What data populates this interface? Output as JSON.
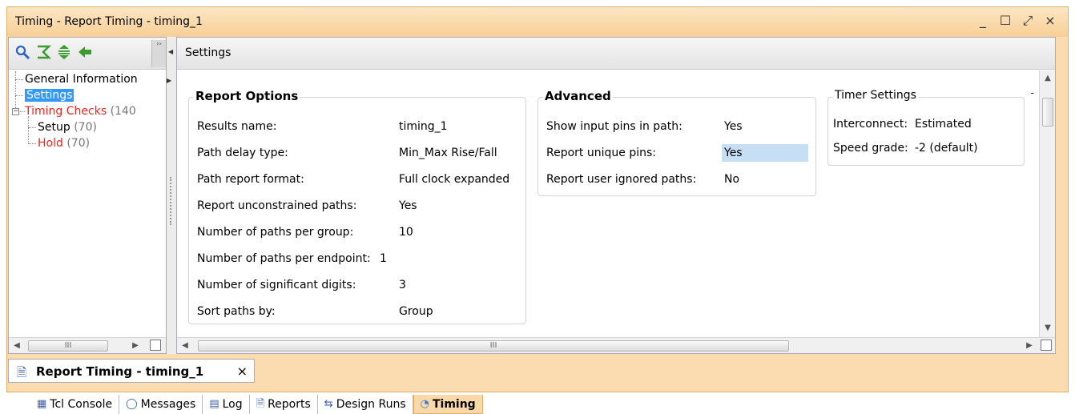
{
  "window": {
    "title": "Timing - Report Timing - timing_1",
    "controls": {
      "minimize": "_",
      "maximize": "☐",
      "restore": "⤢",
      "close": "×"
    }
  },
  "left_panel": {
    "toolbar_icons": [
      "search-icon",
      "sum-icon",
      "expand-icon",
      "back-icon"
    ],
    "tree": {
      "general": "General Information",
      "settings": "Settings",
      "timing_checks": "Timing Checks",
      "timing_checks_count": "(140",
      "setup": "Setup",
      "setup_count": "(70)",
      "hold": "Hold",
      "hold_count": "(70)"
    },
    "scroll_thumb": "III"
  },
  "right_panel": {
    "header": "Settings",
    "scroll_thumb": "III",
    "report_options": {
      "title": "Report Options",
      "rows": [
        {
          "label": "Results name:",
          "value": "timing_1"
        },
        {
          "label": "Path delay type:",
          "value": "Min_Max Rise/Fall"
        },
        {
          "label": "Path report format:",
          "value": "Full clock expanded"
        },
        {
          "label": "Report unconstrained paths:",
          "value": "Yes"
        },
        {
          "label": "Number of paths per group:",
          "value": "10"
        },
        {
          "label": "Number of paths per endpoint:",
          "value": "1"
        },
        {
          "label": "Number of significant digits:",
          "value": "3"
        },
        {
          "label": "Sort paths by:",
          "value": "Group"
        }
      ]
    },
    "advanced": {
      "title": "Advanced",
      "rows": [
        {
          "label": "Show input pins in path:",
          "value": "Yes"
        },
        {
          "label": "Report unique pins:",
          "value": "Yes"
        },
        {
          "label": "Report user ignored paths:",
          "value": "No"
        }
      ]
    },
    "timer_settings": {
      "title": "Timer Settings",
      "rows": [
        {
          "label": "Interconnect:",
          "value": "Estimated"
        },
        {
          "label": "Speed grade:",
          "value": "-2 (default)"
        }
      ]
    }
  },
  "document_tab": {
    "label": "Report Timing - timing_1",
    "close": "×"
  },
  "bottom_tabs": [
    {
      "label": "Tcl Console",
      "icon": "console-icon"
    },
    {
      "label": "Messages",
      "icon": "message-icon"
    },
    {
      "label": "Log",
      "icon": "log-icon"
    },
    {
      "label": "Reports",
      "icon": "reports-icon"
    },
    {
      "label": "Design Runs",
      "icon": "design-runs-icon"
    },
    {
      "label": "Timing",
      "icon": "timing-icon",
      "active": true
    }
  ],
  "colors": {
    "accent": "#fbdcb0",
    "selection": "#3399ff",
    "highlight": "#c7dff5",
    "error": "#e8251b"
  }
}
